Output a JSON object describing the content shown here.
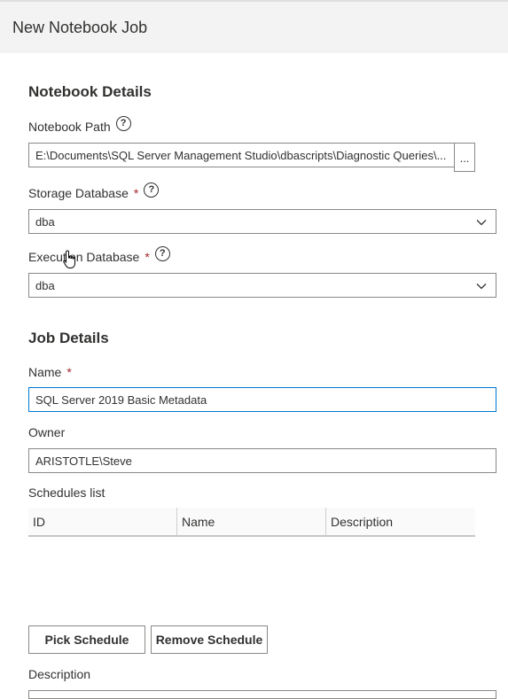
{
  "header": {
    "title": "New Notebook Job"
  },
  "notebook_details": {
    "title": "Notebook Details",
    "notebook_path": {
      "label": "Notebook Path",
      "value": "E:\\Documents\\SQL Server Management Studio\\dbascripts\\Diagnostic Queries\\...",
      "browse_label": "..."
    },
    "storage_database": {
      "label": "Storage Database",
      "required_mark": "*",
      "value": "dba"
    },
    "execution_database": {
      "label": "Execution Database",
      "required_mark": "*",
      "value": "dba"
    }
  },
  "job_details": {
    "title": "Job Details",
    "name": {
      "label": "Name",
      "required_mark": "*",
      "value": "SQL Server 2019 Basic Metadata"
    },
    "owner": {
      "label": "Owner",
      "value": "ARISTOTLE\\Steve"
    },
    "schedules": {
      "label": "Schedules list",
      "columns": [
        "ID",
        "Name",
        "Description"
      ],
      "rows": []
    },
    "pick_schedule_label": "Pick Schedule",
    "remove_schedule_label": "Remove Schedule",
    "description_label": "Description"
  },
  "icons": {
    "help": "question-circle-icon",
    "dropdown": "chevron-down-icon",
    "cursor": "hand-pointer-icon"
  },
  "colors": {
    "header_bg": "#f3f3f3",
    "focus_border": "#0078d4",
    "required": "#a4262c"
  }
}
